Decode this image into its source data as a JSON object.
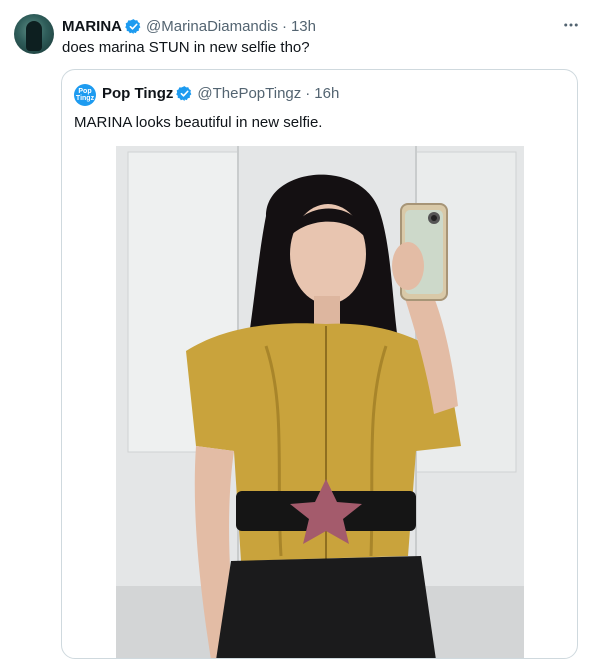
{
  "tweet": {
    "name": "MARINA",
    "handle": "@MarinaDiamandis",
    "separator": "·",
    "time": "13h",
    "text": "does marina STUN in new selfie tho?",
    "more_icon": "more-horizontal-icon"
  },
  "quote": {
    "avatar_label": "Pop Tingz",
    "name": "Pop Tingz",
    "handle": "@ThePopTingz",
    "separator": "·",
    "time": "16h",
    "text": "MARINA looks beautiful in new selfie."
  },
  "colors": {
    "text": "#0f1419",
    "secondary": "#536471",
    "verified": "#1d9bf0",
    "border": "#cfd9de"
  }
}
